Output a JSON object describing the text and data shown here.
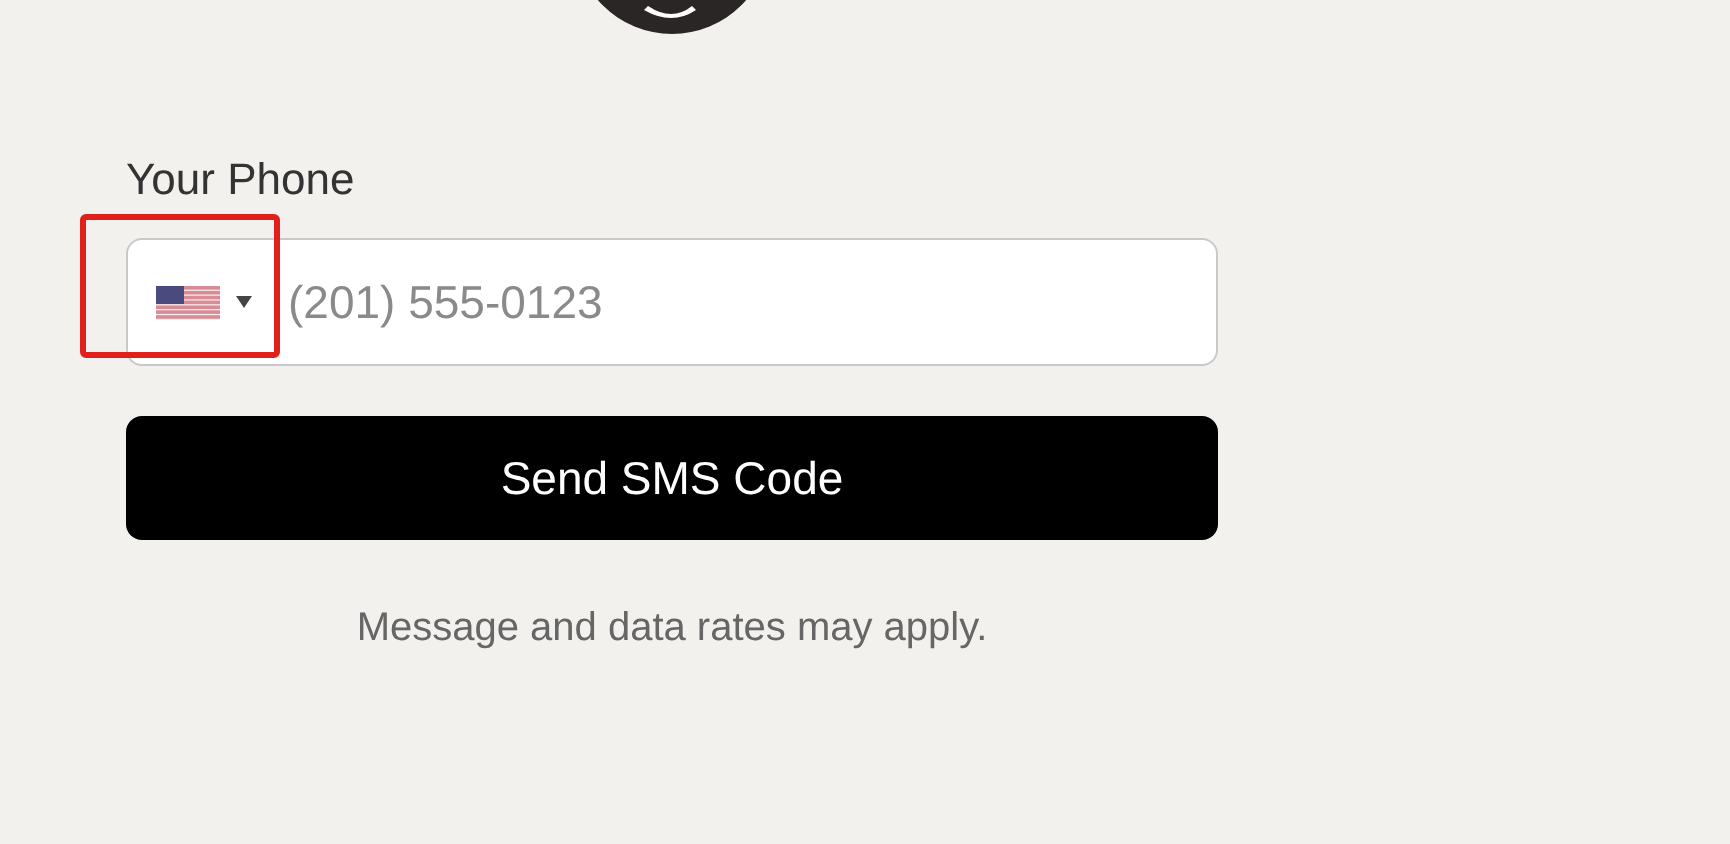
{
  "phone_field": {
    "label": "Your Phone",
    "placeholder": "(201) 555-0123",
    "highlighted": true
  },
  "submit_button": {
    "label": "Send SMS Code"
  },
  "disclaimer": "Message and data rates may apply."
}
